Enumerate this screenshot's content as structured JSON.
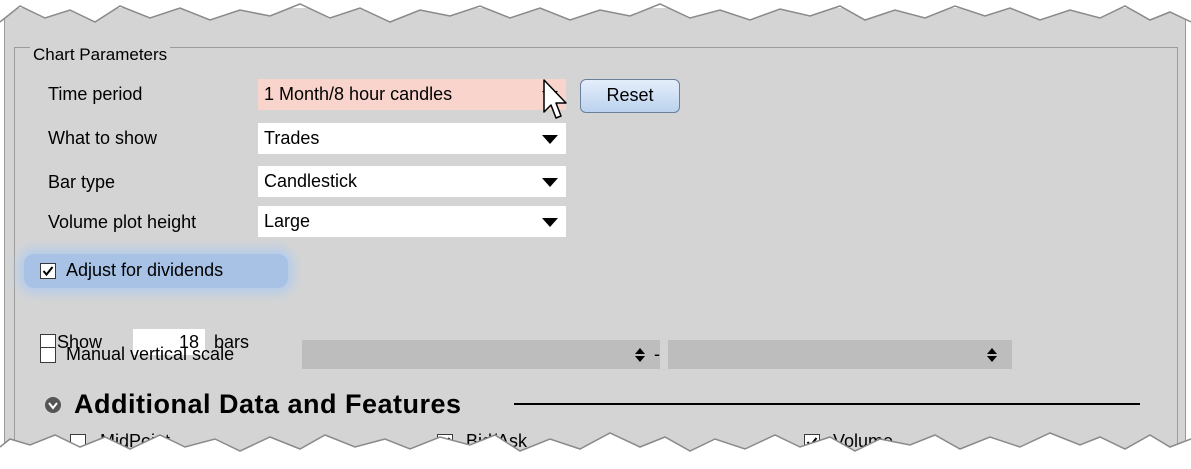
{
  "chart_parameters": {
    "legend": "Chart Parameters",
    "time_period": {
      "label": "Time period",
      "value": "1 Month/8 hour candles"
    },
    "reset_label": "Reset",
    "what_to_show": {
      "label": "What to show",
      "value": "Trades"
    },
    "bar_type": {
      "label": "Bar type",
      "value": "Candlestick"
    },
    "volume_plot_height": {
      "label": "Volume plot height",
      "value": "Large"
    },
    "adjust_dividends": {
      "label": "Adjust for dividends",
      "checked": true
    },
    "show_bars": {
      "label_pre": "Show",
      "value": "18",
      "label_post": "bars",
      "checked": false
    },
    "manual_vertical_scale": {
      "label": "Manual vertical scale",
      "separator": "-",
      "checked": false
    }
  },
  "additional": {
    "title": "Additional Data and Features",
    "midpoint": {
      "label": "MidPoint",
      "checked": false
    },
    "bid_ask": {
      "label": "Bid/Ask",
      "checked": true
    },
    "volume": {
      "label": "Volume",
      "checked": true
    }
  },
  "colors": {
    "panel": "#d4d4d4",
    "highlight_combo": "#f9d4cc",
    "focus_glow": "#a8c2e6",
    "reset_button": "#c9dbf3"
  }
}
